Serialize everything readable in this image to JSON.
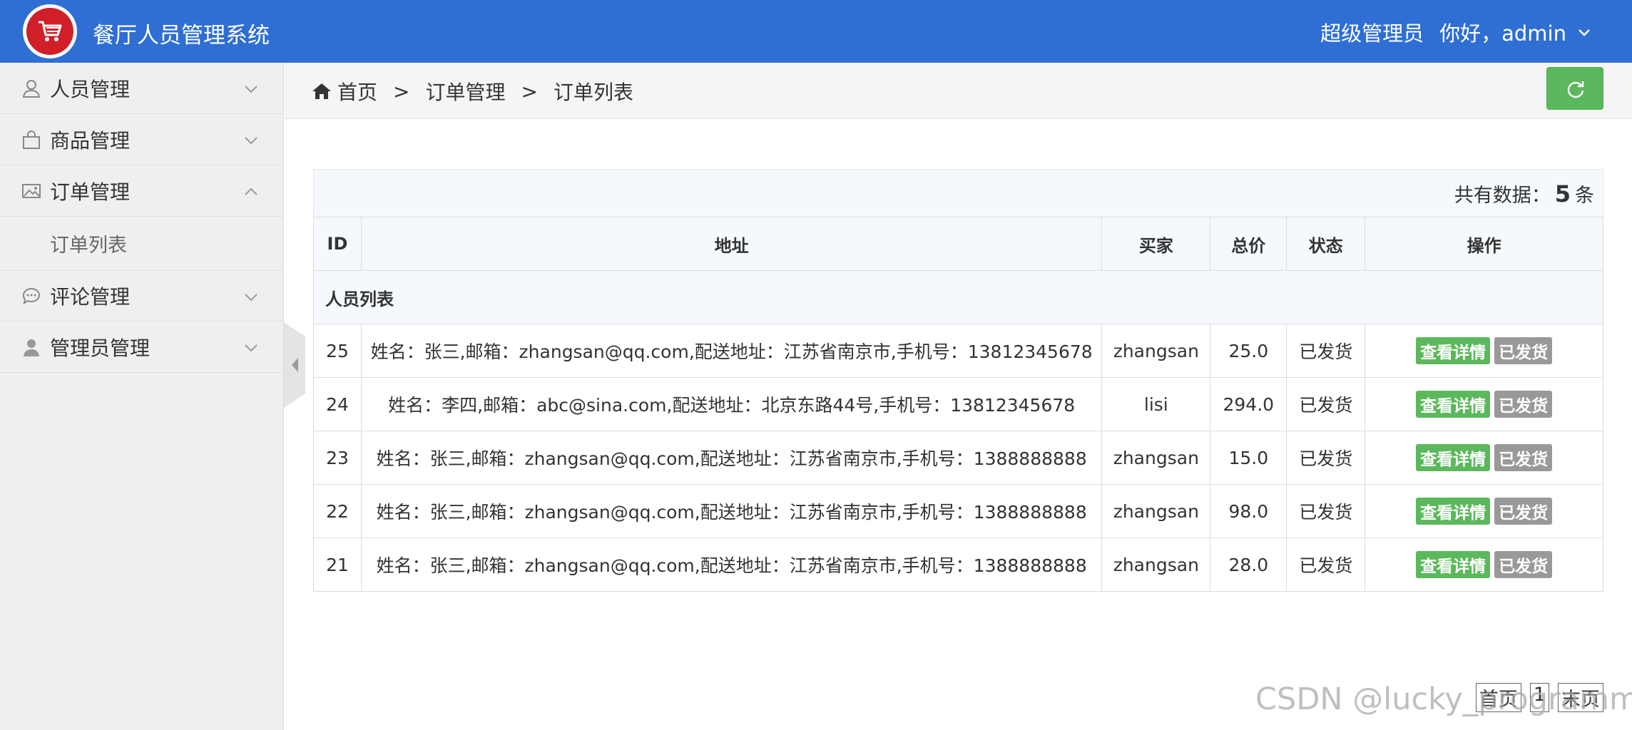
{
  "header": {
    "app_title": "餐厅人员管理系统",
    "role": "超级管理员",
    "greeting": "你好，admin",
    "brand_color": "#2f6fd3"
  },
  "sidebar": {
    "items": [
      {
        "label": "人员管理",
        "icon": "user-icon"
      },
      {
        "label": "商品管理",
        "icon": "shopping-bag-icon"
      },
      {
        "label": "订单管理",
        "icon": "image-icon"
      },
      {
        "label": "评论管理",
        "icon": "chat-icon"
      },
      {
        "label": "管理员管理",
        "icon": "admin-user-icon"
      }
    ],
    "submenu_label": "订单列表"
  },
  "breadcrumb": {
    "home": "首页",
    "sep": ">",
    "level1": "订单管理",
    "level2": "订单列表"
  },
  "summary": {
    "prefix": "共有数据：",
    "count": "5",
    "suffix": "条"
  },
  "table": {
    "title": "人员列表",
    "headers": {
      "id": "ID",
      "address": "地址",
      "buyer": "买家",
      "total": "总价",
      "status": "状态",
      "action": "操作"
    },
    "view_label": "查看详情",
    "shipped_label": "已发货",
    "rows": [
      {
        "id": "25",
        "address": "姓名：张三,邮箱：zhangsan@qq.com,配送地址：江苏省南京市,手机号：13812345678",
        "buyer": "zhangsan",
        "total": "25.0",
        "status": "已发货"
      },
      {
        "id": "24",
        "address": "姓名：李四,邮箱：abc@sina.com,配送地址：北京东路44号,手机号：13812345678",
        "buyer": "lisi",
        "total": "294.0",
        "status": "已发货"
      },
      {
        "id": "23",
        "address": "姓名：张三,邮箱：zhangsan@qq.com,配送地址：江苏省南京市,手机号：1388888888",
        "buyer": "zhangsan",
        "total": "15.0",
        "status": "已发货"
      },
      {
        "id": "22",
        "address": "姓名：张三,邮箱：zhangsan@qq.com,配送地址：江苏省南京市,手机号：1388888888",
        "buyer": "zhangsan",
        "total": "98.0",
        "status": "已发货"
      },
      {
        "id": "21",
        "address": "姓名：张三,邮箱：zhangsan@qq.com,配送地址：江苏省南京市,手机号：1388888888",
        "buyer": "zhangsan",
        "total": "28.0",
        "status": "已发货"
      }
    ]
  },
  "pager": {
    "first": "首页",
    "page": "1",
    "last": "末页"
  },
  "watermark": "CSDN @lucky_programmer"
}
